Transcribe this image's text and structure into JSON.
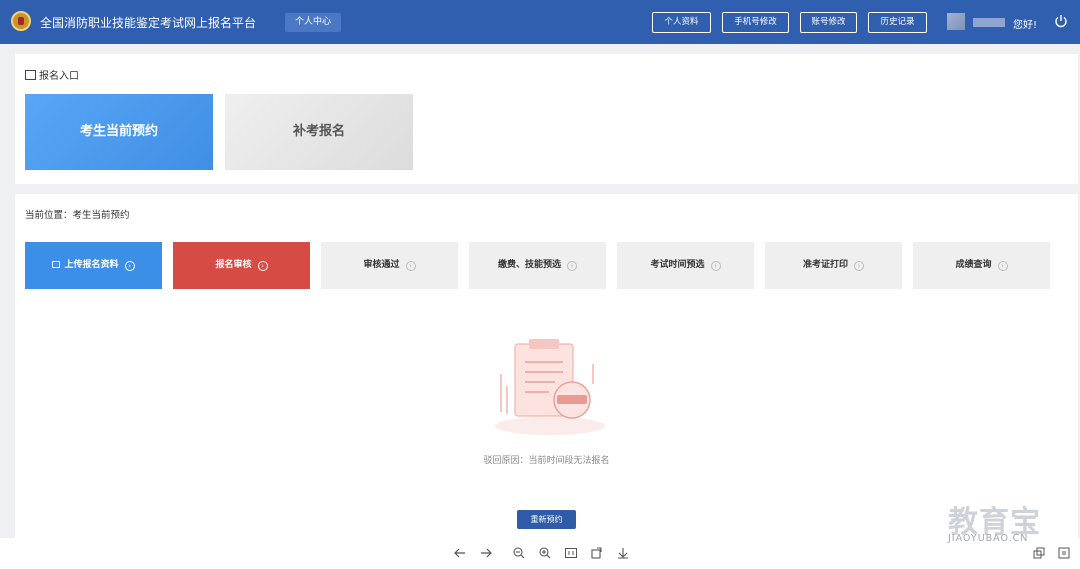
{
  "header": {
    "app_title": "全国消防职业技能鉴定考试网上报名平台",
    "personal_center": "个人中心",
    "buttons": [
      "个人资料",
      "手机号修改",
      "账号修改",
      "历史记录"
    ],
    "greeting": "您好!"
  },
  "entry": {
    "section_title": "报名入口",
    "cards": [
      "考生当前预约",
      "补考报名"
    ]
  },
  "main": {
    "location_label": "当前位置：",
    "location_value": "考生当前预约",
    "steps": [
      "上传报名资料",
      "报名审核",
      "审核通过",
      "缴费、技能预选",
      "考试时间预选",
      "准考证打印",
      "成绩查询"
    ],
    "reject_reason": "驳回原因：当前时间段无法报名",
    "redo_button": "重新预约"
  },
  "watermark": {
    "brand": "教育宝",
    "domain": "JIAOYUBAO.CN"
  },
  "colors": {
    "header_bg": "#2f5fae",
    "step_active": "#3c8fe6",
    "step_rejected": "#d64c45",
    "button_dark": "#2e5ca8"
  }
}
